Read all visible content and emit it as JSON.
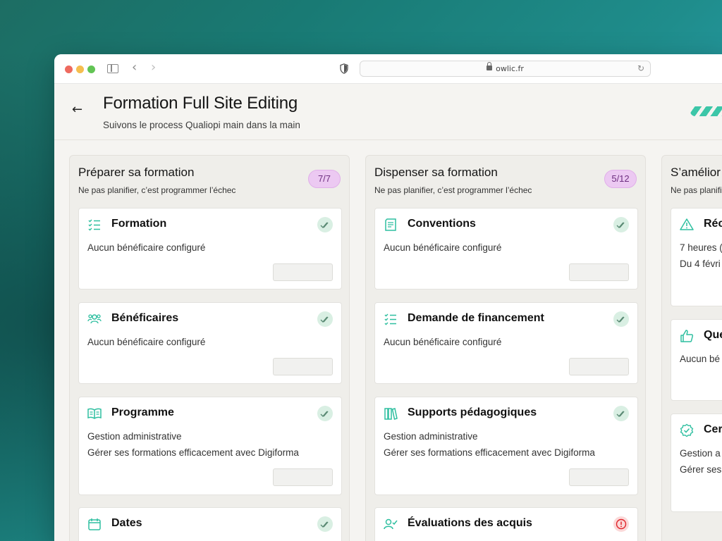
{
  "browser": {
    "url": "owlic.fr"
  },
  "header": {
    "title": "Formation Full Site Editing",
    "subtitle": "Suivons le process Qualiopi main dans la main"
  },
  "columns": [
    {
      "title": "Préparer sa formation",
      "subtitle": "Ne pas planifier, c’est programmer l’échec",
      "count": "7/7",
      "cards": [
        {
          "title": "Formation",
          "icon": "checklist-icon",
          "status": "done",
          "lines": [
            "Aucun bénéficaire configuré"
          ]
        },
        {
          "title": "Bénéficaires",
          "icon": "users-icon",
          "status": "done",
          "lines": [
            "Aucun bénéficaire configuré"
          ]
        },
        {
          "title": "Programme",
          "icon": "book-open-icon",
          "status": "done",
          "lines": [
            "Gestion administrative",
            "Gérer ses formations efficacement avec Digiforma"
          ]
        },
        {
          "title": "Dates",
          "icon": "calendar-icon",
          "status": "done",
          "lines": []
        }
      ]
    },
    {
      "title": "Dispenser sa formation",
      "subtitle": "Ne pas planifier, c’est programmer l’échec",
      "count": "5/12",
      "cards": [
        {
          "title": "Conventions",
          "icon": "document-icon",
          "status": "done",
          "lines": [
            "Aucun bénéficaire configuré"
          ]
        },
        {
          "title": "Demande de financement",
          "icon": "checklist-icon",
          "status": "done",
          "lines": [
            "Aucun bénéficaire configuré"
          ]
        },
        {
          "title": "Supports pédagogiques",
          "icon": "books-icon",
          "status": "done",
          "lines": [
            "Gestion administrative",
            "Gérer ses formations efficacement avec Digiforma"
          ]
        },
        {
          "title": "Évaluations des acquis",
          "icon": "user-check-icon",
          "status": "error",
          "lines": []
        }
      ]
    },
    {
      "title": "S’amélior",
      "subtitle": "Ne pas planifi",
      "cards": [
        {
          "title": "Réc",
          "icon": "warning-icon",
          "lines": [
            "7 heures (",
            "Du 4 févri"
          ]
        },
        {
          "title": "Que",
          "icon": "thumbs-up-icon",
          "lines": [
            "Aucun bé"
          ]
        },
        {
          "title": "Cer",
          "icon": "badge-check-icon",
          "lines": [
            "Gestion a",
            "Gérer ses"
          ]
        }
      ]
    }
  ],
  "colors": {
    "accent": "#3cc6a8",
    "badge_bg": "#ecc9f2",
    "status_ok": "#d9efe3",
    "status_error": "#e0242a"
  }
}
